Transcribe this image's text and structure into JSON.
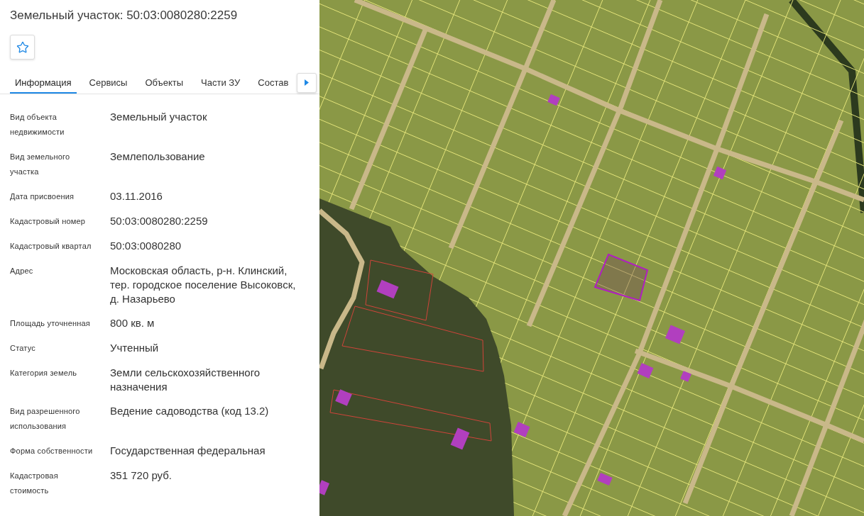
{
  "title": "Земельный участок: 50:03:0080280:2259",
  "favorite_button": {
    "favorited": false
  },
  "tabs": [
    {
      "label": "Информация",
      "selected": true
    },
    {
      "label": "Сервисы",
      "selected": false
    },
    {
      "label": "Объекты",
      "selected": false
    },
    {
      "label": "Части ЗУ",
      "selected": false
    },
    {
      "label": "Состав",
      "selected": false
    }
  ],
  "fields": [
    {
      "label": "Вид объекта недвижимости",
      "value": "Земельный участок"
    },
    {
      "label": "Вид земельного участка",
      "value": "Землепользование"
    },
    {
      "label": "Дата присвоения",
      "value": "03.11.2016"
    },
    {
      "label": "Кадастровый номер",
      "value": "50:03:0080280:2259"
    },
    {
      "label": "Кадастровый квартал",
      "value": "50:03:0080280"
    },
    {
      "label": "Адрес",
      "value": "Московская область, р-н. Клинский, тер. городское поселение Высоковск, д. Назарьево"
    },
    {
      "label": "Площадь уточненная",
      "value": "800 кв. м"
    },
    {
      "label": "Статус",
      "value": "Учтенный"
    },
    {
      "label": "Категория земель",
      "value": "Земли сельскохозяйственного назначения"
    },
    {
      "label": "Вид разрешенного использования",
      "value": "Ведение садоводства (код 13.2)"
    },
    {
      "label": "Форма собственности",
      "value": "Государственная федеральная"
    },
    {
      "label": "Кадастровая стоимость",
      "value": "351 720 руб."
    }
  ]
}
